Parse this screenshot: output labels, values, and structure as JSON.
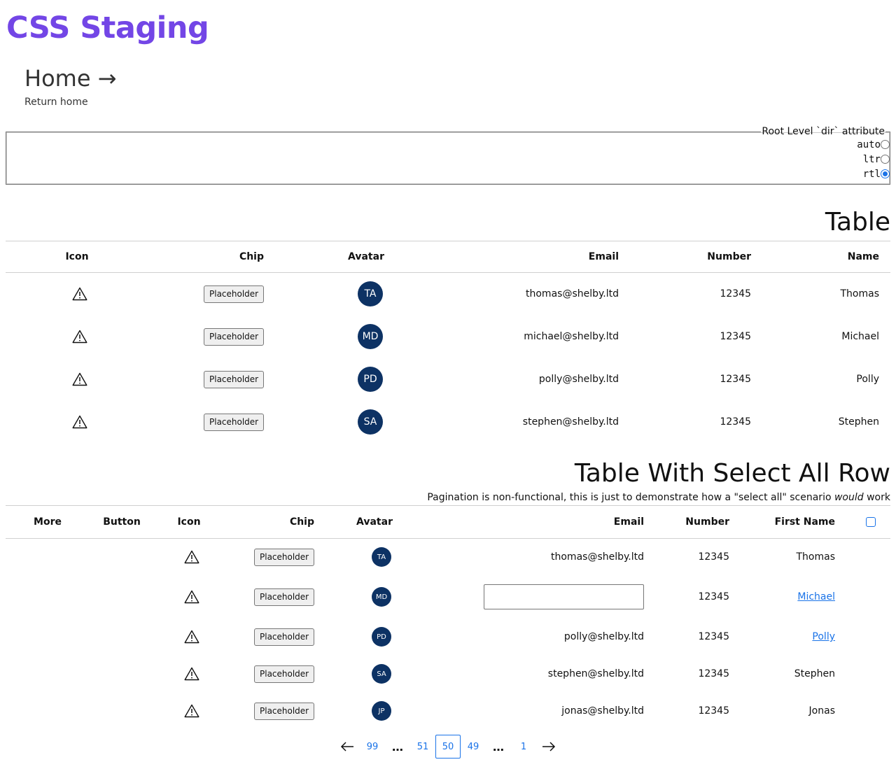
{
  "site": {
    "title": "CSS Staging"
  },
  "breadcrumb": {
    "title": "Home →",
    "subtitle": "Return home"
  },
  "dir_control": {
    "legend": "Root Level `dir` attribute",
    "options": [
      {
        "value": "auto",
        "checked": false
      },
      {
        "value": "ltr",
        "checked": false
      },
      {
        "value": "rtl",
        "checked": true
      }
    ]
  },
  "table1": {
    "title": "Table",
    "headers": {
      "icon": "Icon",
      "chip": "Chip",
      "avatar": "Avatar",
      "email": "Email",
      "number": "Number",
      "name": "Name"
    },
    "rows": [
      {
        "icon": "warning-icon",
        "chip": "Placeholder",
        "initials": "TA",
        "email": "thomas@shelby.ltd",
        "number": "12345",
        "name": "Thomas"
      },
      {
        "icon": "warning-icon",
        "chip": "Placeholder",
        "initials": "MD",
        "email": "michael@shelby.ltd",
        "number": "12345",
        "name": "Michael"
      },
      {
        "icon": "warning-icon",
        "chip": "Placeholder",
        "initials": "PD",
        "email": "polly@shelby.ltd",
        "number": "12345",
        "name": "Polly"
      },
      {
        "icon": "warning-icon",
        "chip": "Placeholder",
        "initials": "SA",
        "email": "stephen@shelby.ltd",
        "number": "12345",
        "name": "Stephen"
      }
    ]
  },
  "table2": {
    "title": "Table With Select All Row",
    "description_pre": "Pagination is non-functional, this is just to demonstrate how a \"select all\" scenario ",
    "description_em": "would",
    "description_post": " work",
    "headers": {
      "more": "More",
      "button": "Button",
      "icon": "Icon",
      "chip": "Chip",
      "avatar": "Avatar",
      "email": "Email",
      "number": "Number",
      "first_name": "First Name"
    },
    "rows": [
      {
        "icon": "warning-icon",
        "chip": "Placeholder",
        "initials": "TA",
        "email": "thomas@shelby.ltd",
        "number": "12345",
        "name": "Thomas",
        "name_link": false
      },
      {
        "icon": "warning-icon",
        "chip": "Placeholder",
        "initials": "MD",
        "email": "",
        "email_editing": true,
        "number": "12345",
        "name": "Michael",
        "name_link": true
      },
      {
        "icon": "warning-icon",
        "chip": "Placeholder",
        "initials": "PD",
        "email": "polly@shelby.ltd",
        "number": "12345",
        "name": "Polly",
        "name_link": true
      },
      {
        "icon": "warning-icon",
        "chip": "Placeholder",
        "initials": "SA",
        "email": "stephen@shelby.ltd",
        "number": "12345",
        "name": "Stephen",
        "name_link": false
      },
      {
        "icon": "warning-icon",
        "chip": "Placeholder",
        "initials": "JP",
        "email": "jonas@shelby.ltd",
        "number": "12345",
        "name": "Jonas",
        "name_link": false
      }
    ]
  },
  "pagination": {
    "prev_icon": "arrow-left-icon",
    "next_icon": "arrow-right-icon",
    "items": [
      "99",
      "…",
      "51",
      "50",
      "49",
      "…",
      "1"
    ],
    "current": "50"
  },
  "colors": {
    "brand": "#7346e6",
    "avatar_bg": "#0d3264",
    "link": "#1a73e8"
  }
}
